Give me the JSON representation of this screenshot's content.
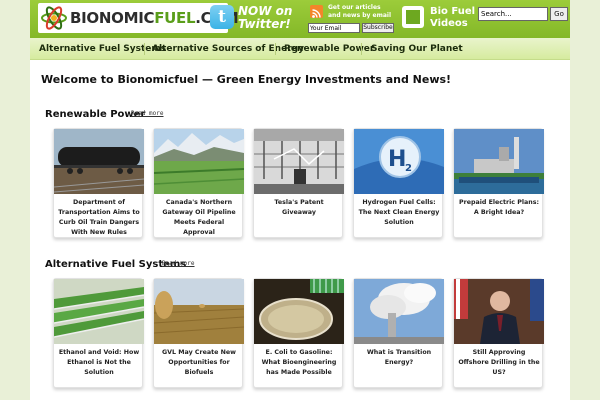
{
  "header": {
    "logo_part1": "BIONOMIC",
    "logo_part2": "FUEL",
    "logo_suffix": ".COM",
    "twitter_line1": "NOW on",
    "twitter_line2": "Twitter!",
    "rss_line1": "Get our articles",
    "rss_line2": "and news by email",
    "email_placeholder": "Your Email",
    "subscribe_label": "Subscribe",
    "video_line1": "Bio Fuel",
    "video_line2": "Videos",
    "search_value": "Search...",
    "go_label": "Go"
  },
  "nav": {
    "items": [
      {
        "label": "Alternative Fuel Systems"
      },
      {
        "label": "Alternative Sources of Energy"
      },
      {
        "label": "Renewable Power"
      },
      {
        "label": "Saving Our Planet"
      }
    ]
  },
  "welcome": "Welcome to Bionomicfuel — Green Energy Investments and News!",
  "sections": [
    {
      "title": "Renewable Power",
      "read_more": "Read more",
      "cards": [
        {
          "caption": "Department of Transportation Aims to Curb Oil Train Dangers With New Rules"
        },
        {
          "caption": "Canada's Northern Gateway Oil Pipeline Meets Federal Approval"
        },
        {
          "caption": "Tesla's Patent Giveaway"
        },
        {
          "caption": "Hydrogen Fuel Cells: The Next Clean Energy Solution"
        },
        {
          "caption": "Prepaid Electric Plans: A Bright Idea?"
        }
      ]
    },
    {
      "title": "Alternative Fuel Systems",
      "read_more": "Read more",
      "cards": [
        {
          "caption": "Ethanol and Void: How Ethanol is Not the Solution"
        },
        {
          "caption": "GVL May Create New Opportunities for Biofuels"
        },
        {
          "caption": "E. Coli to Gasoline: What Bioengineering has Made Possible"
        },
        {
          "caption": "What is Transition Energy?"
        },
        {
          "caption": "Still Approving Offshore Drilling in the US?"
        }
      ]
    }
  ],
  "colors": {
    "header_green": "#84b828",
    "nav_bg": "#d6eb9f",
    "page_bg": "#e9f0d7"
  }
}
